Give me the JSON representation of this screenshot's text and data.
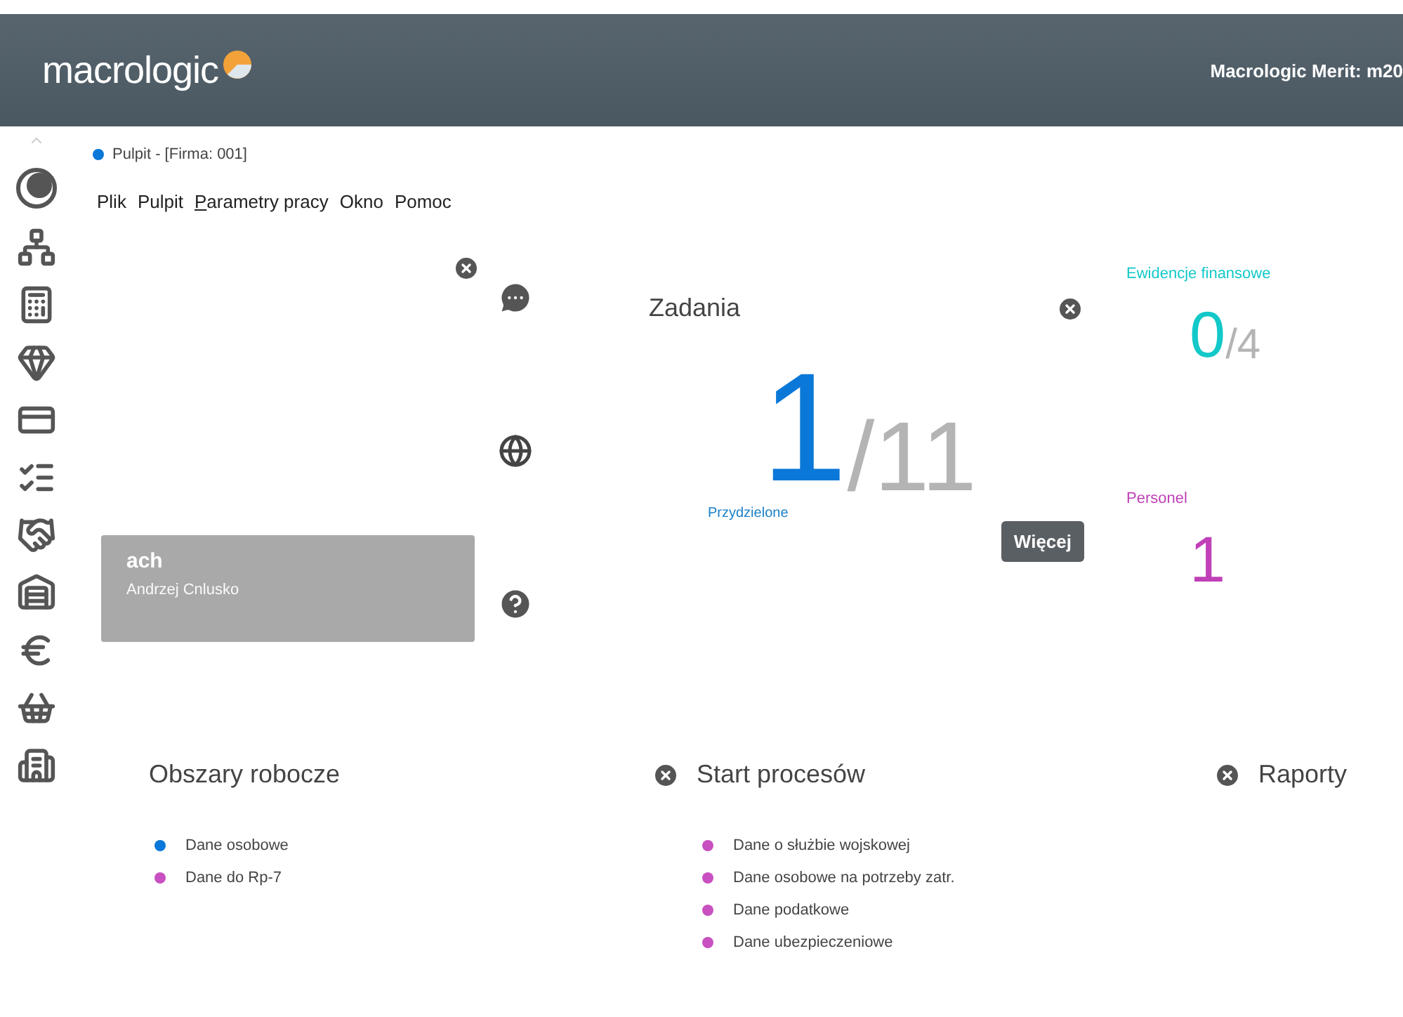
{
  "header": {
    "logo": "macrologic",
    "product": "Macrologic Merit: m20"
  },
  "window": {
    "title": "Pulpit - [Firma: 001]",
    "color": "#0a78d8"
  },
  "menu": [
    {
      "label": "Plik",
      "underlined_first": false
    },
    {
      "label": "Pulpit",
      "underlined_first": false
    },
    {
      "label": "Parametry pracy",
      "underlined_first": true
    },
    {
      "label": "Okno",
      "underlined_first": false
    },
    {
      "label": "Pomoc",
      "underlined_first": false
    }
  ],
  "user_card": {
    "login": "ach",
    "name": "Andrzej Cnlusko"
  },
  "tasks": {
    "title": "Zadania",
    "count": "1",
    "total": "/11",
    "caption": "Przydzielone",
    "button": "Więcej"
  },
  "summaries": [
    {
      "label": "Ewidencje finansowe",
      "count": "0",
      "total": "/4",
      "color": "#12c8c8"
    },
    {
      "label": "Personel",
      "count": "1",
      "color": "#c040b8"
    }
  ],
  "panels": [
    {
      "title": "Obszary robocze",
      "items": [
        {
          "text": "Dane osobowe",
          "color": "#0a78d8"
        },
        {
          "text": "Dane do Rp-7",
          "color": "#c850c0"
        }
      ]
    },
    {
      "title": "Start procesów",
      "items": [
        {
          "text": "Dane o służbie wojskowej",
          "color": "#c850c0"
        },
        {
          "text": "Dane osobowe na potrzeby zatr.",
          "color": "#c850c0"
        },
        {
          "text": "Dane podatkowe",
          "color": "#c850c0"
        },
        {
          "text": "Dane ubezpieczeniowe",
          "color": "#c850c0"
        }
      ]
    },
    {
      "title": "Raporty"
    }
  ]
}
